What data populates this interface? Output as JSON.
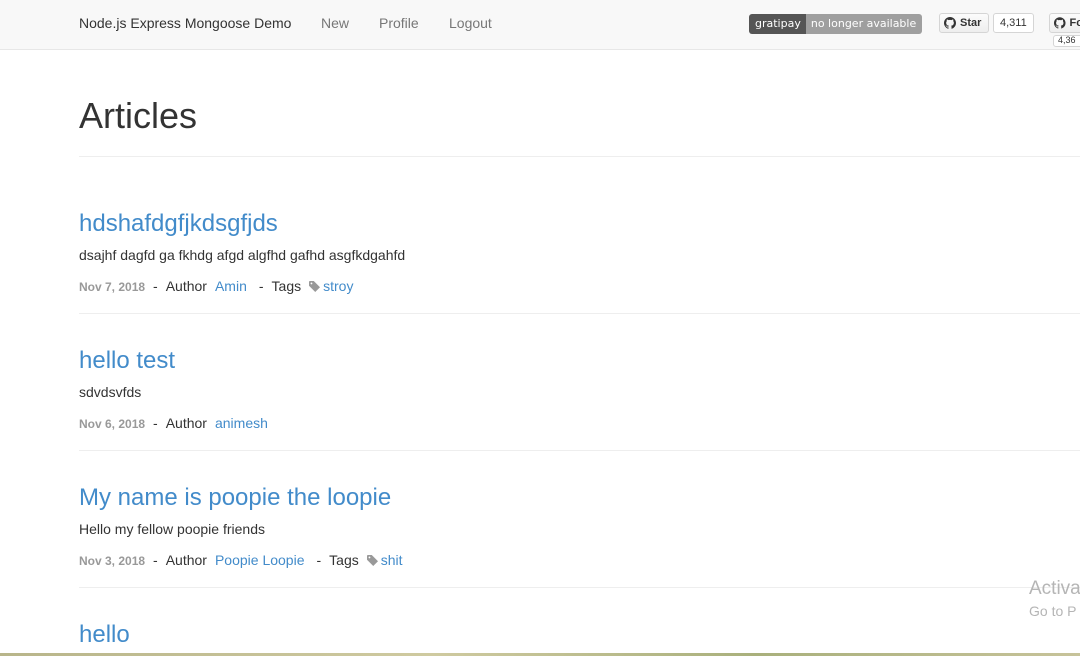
{
  "navbar": {
    "brand": "Node.js Express Mongoose Demo",
    "links": [
      "New",
      "Profile",
      "Logout"
    ],
    "badge": {
      "left": "gratipay",
      "right": "no longer available"
    },
    "github_star": {
      "label": "Star",
      "count": "4,311"
    },
    "github_fork": {
      "label": "Fo",
      "count": "4,36"
    }
  },
  "page": {
    "title": "Articles"
  },
  "articles": [
    {
      "title": "hdshafdgfjkdsgfjds",
      "body": "dsajhf dagfd ga fkhdg afgd algfhd gafhd asgfkdgahfd",
      "date": "Nov 7, 2018",
      "separator": "-",
      "author_label": "Author",
      "author": "Amin",
      "tags_label": "Tags",
      "tag": "stroy"
    },
    {
      "title": "hello test",
      "body": "sdvdsvfds",
      "date": "Nov 6, 2018",
      "separator": "-",
      "author_label": "Author",
      "author": "animesh"
    },
    {
      "title": "My name is poopie the loopie",
      "body": "Hello my fellow poopie friends",
      "date": "Nov 3, 2018",
      "separator": "-",
      "author_label": "Author",
      "author": "Poopie Loopie",
      "tags_label": "Tags",
      "tag": "shit"
    },
    {
      "title": "hello"
    }
  ],
  "watermark": {
    "line1": "Activa",
    "line2": "Go to P"
  },
  "colors": {
    "link": "#428bca",
    "navbar_bg": "#f8f8f8",
    "muted": "#999999"
  }
}
